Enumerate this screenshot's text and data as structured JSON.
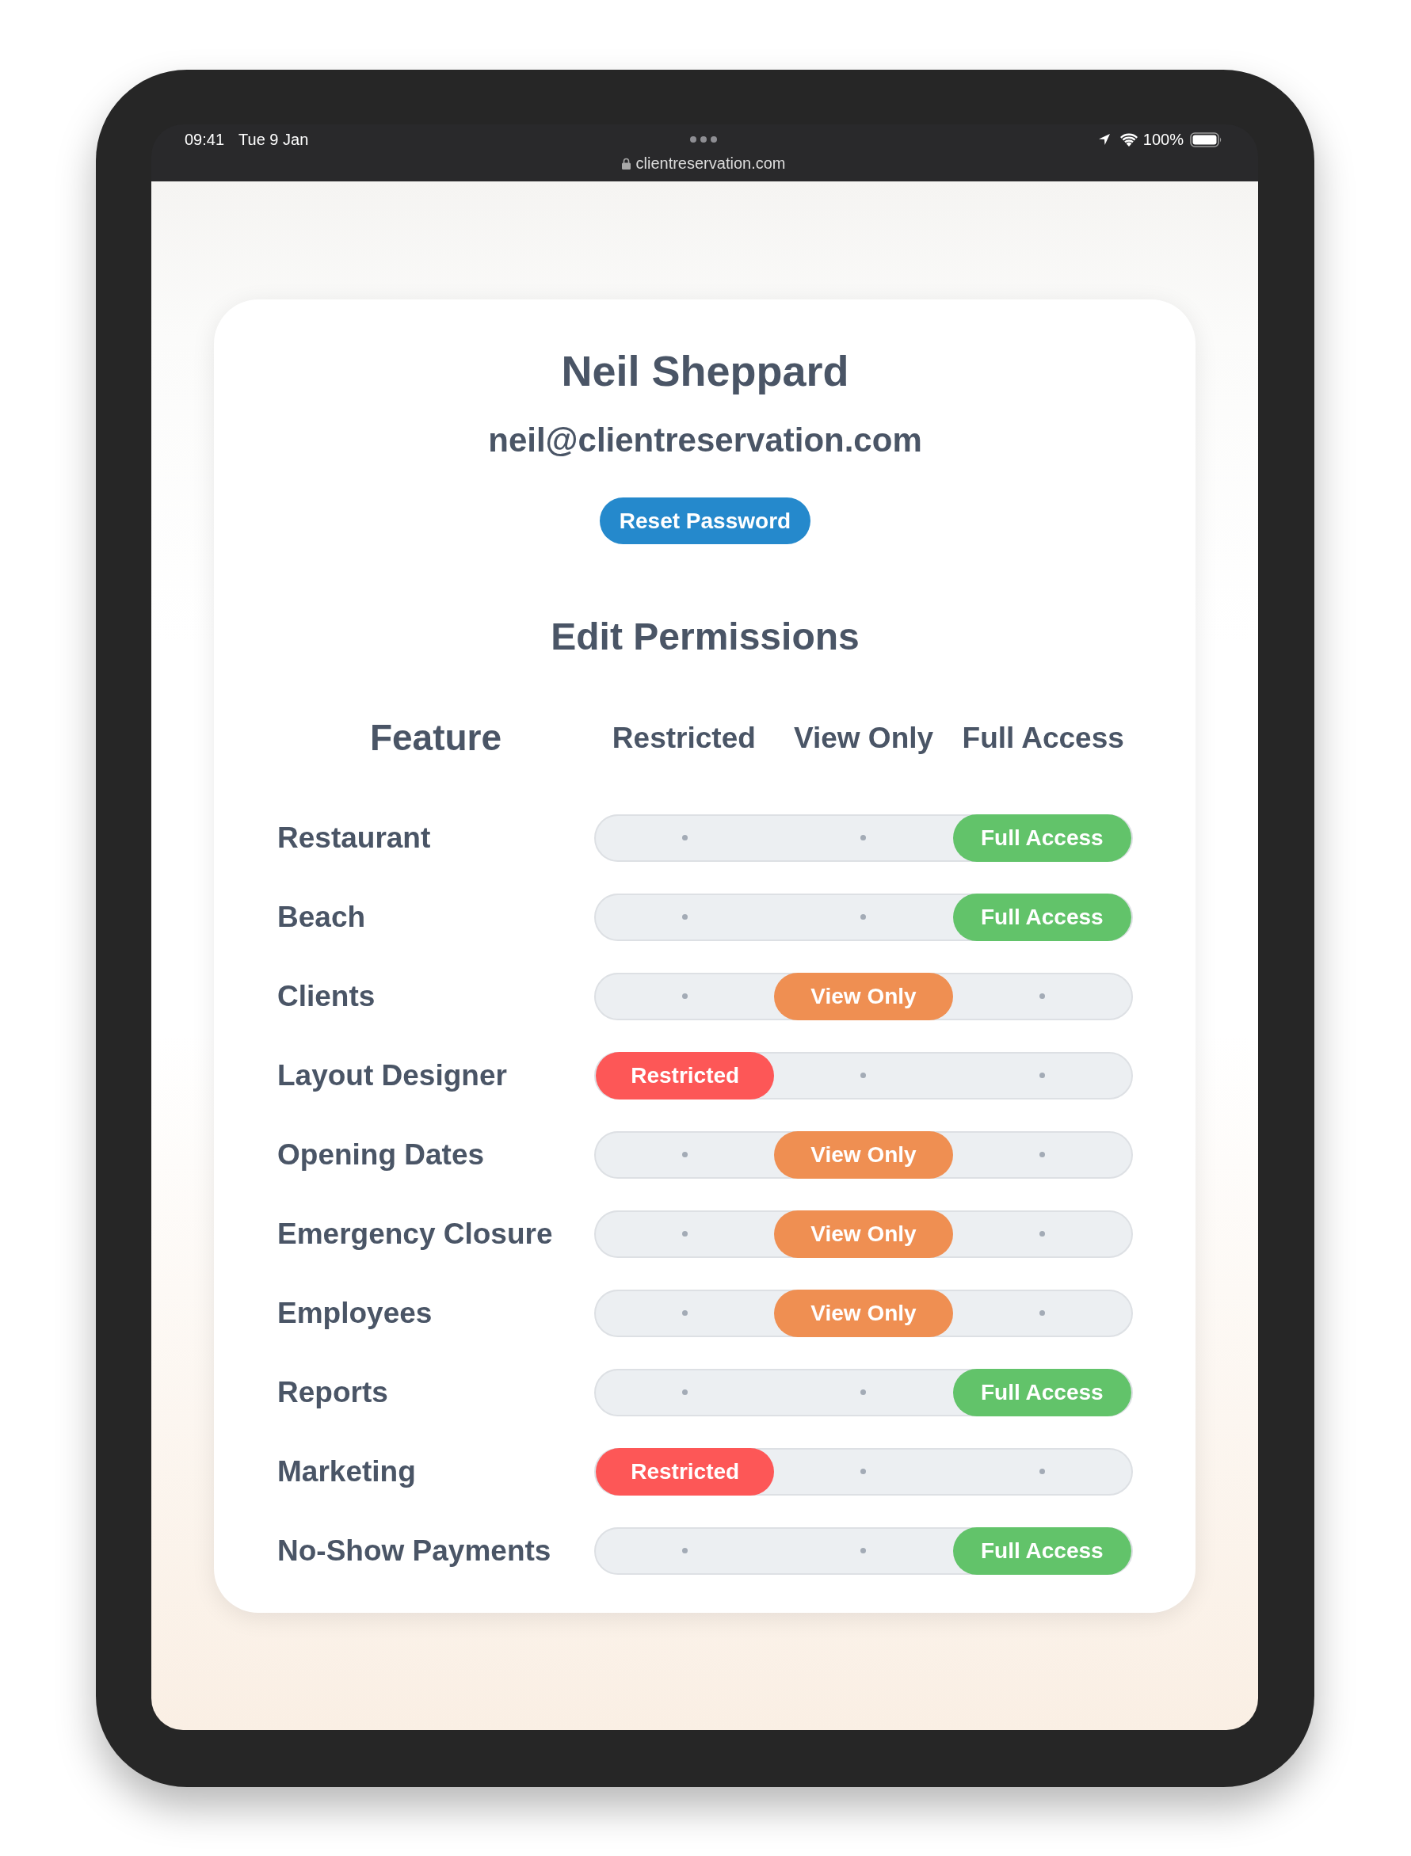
{
  "status_bar": {
    "time": "09:41",
    "date": "Tue 9 Jan",
    "url": "clientreservation.com",
    "battery": "100%"
  },
  "profile": {
    "name": "Neil Sheppard",
    "email": "neil@clientreservation.com",
    "button": "Reset Password"
  },
  "permissions": {
    "title": "Edit Permissions",
    "columns": [
      "Feature",
      "Restricted",
      "View Only",
      "Full Access"
    ],
    "rows": [
      {
        "feature": "Restaurant",
        "segments": [
          {
            "selected": false
          },
          {
            "selected": false
          },
          {
            "selected": true,
            "label": "Full Access",
            "color": "#62c36a"
          }
        ]
      },
      {
        "feature": "Beach",
        "segments": [
          {
            "selected": false
          },
          {
            "selected": false
          },
          {
            "selected": true,
            "label": "Full Access",
            "color": "#62c36a"
          }
        ]
      },
      {
        "feature": "Clients",
        "segments": [
          {
            "selected": false
          },
          {
            "selected": true,
            "label": "View Only",
            "color": "#ef8f52"
          },
          {
            "selected": false
          }
        ]
      },
      {
        "feature": "Layout Designer",
        "segments": [
          {
            "selected": true,
            "label": "Restricted",
            "color": "#fd5757"
          },
          {
            "selected": false
          },
          {
            "selected": false
          }
        ]
      },
      {
        "feature": "Opening Dates",
        "segments": [
          {
            "selected": false
          },
          {
            "selected": true,
            "label": "View Only",
            "color": "#ef8f52"
          },
          {
            "selected": false
          }
        ]
      },
      {
        "feature": "Emergency Closure",
        "segments": [
          {
            "selected": false
          },
          {
            "selected": true,
            "label": "View Only",
            "color": "#ef8f52"
          },
          {
            "selected": false
          }
        ]
      },
      {
        "feature": "Employees",
        "segments": [
          {
            "selected": false
          },
          {
            "selected": true,
            "label": "View Only",
            "color": "#ef8f52"
          },
          {
            "selected": false
          }
        ]
      },
      {
        "feature": "Reports",
        "segments": [
          {
            "selected": false
          },
          {
            "selected": false
          },
          {
            "selected": true,
            "label": "Full Access",
            "color": "#62c36a"
          }
        ]
      },
      {
        "feature": "Marketing",
        "segments": [
          {
            "selected": true,
            "label": "Restricted",
            "color": "#fd5757"
          },
          {
            "selected": false
          },
          {
            "selected": false
          }
        ]
      },
      {
        "feature": "No-Show Payments",
        "segments": [
          {
            "selected": false
          },
          {
            "selected": false
          },
          {
            "selected": true,
            "label": "Full Access",
            "color": "#62c36a"
          }
        ]
      }
    ]
  }
}
